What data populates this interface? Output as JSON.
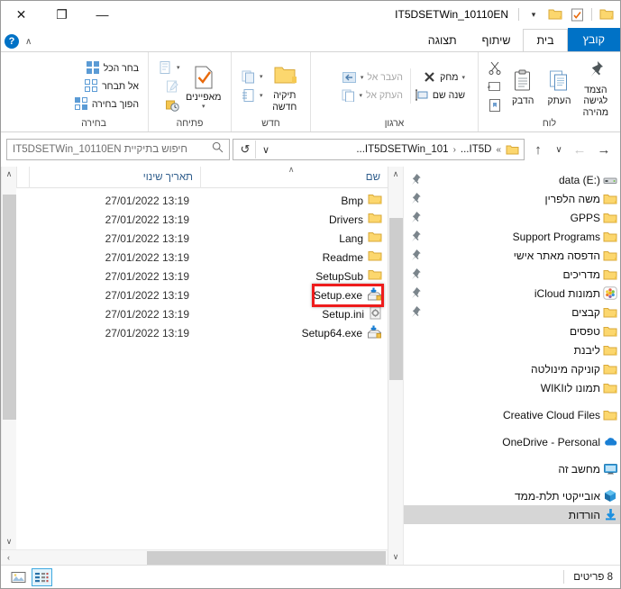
{
  "window": {
    "title": "IT5DSETWin_10110EN",
    "close_label": "✕",
    "maximize_label": "❐",
    "minimize_label": "—"
  },
  "quick_access_toolbar": {
    "items": [
      {
        "name": "customize-qat",
        "glyph": "▾"
      },
      {
        "name": "new-folder-qat",
        "glyph": "folder"
      },
      {
        "name": "properties-qat",
        "glyph": "properties"
      },
      {
        "name": "qat-folder-right",
        "glyph": "folder"
      }
    ]
  },
  "tabs": {
    "file": "קובץ",
    "items": [
      {
        "label": "בית",
        "active": true
      },
      {
        "label": "שיתוף",
        "active": false
      },
      {
        "label": "תצוגה",
        "active": false
      }
    ],
    "help_label": "?",
    "collapse_ribbon_glyph": "∧"
  },
  "ribbon": {
    "groups": [
      {
        "title": "לוח",
        "buttons": [
          {
            "label": "הצמד לגישה מהירה",
            "icon": "pin-icon"
          },
          {
            "label": "העתק",
            "icon": "copy-icon"
          },
          {
            "label": "הדבק",
            "icon": "paste-icon"
          }
        ],
        "small_buttons": [
          {
            "label": "",
            "icon": "cut-icon"
          },
          {
            "label": "",
            "icon": "copy-path-icon"
          },
          {
            "label": "",
            "icon": "paste-shortcut-icon"
          }
        ]
      },
      {
        "title": "ארגון",
        "small_buttons": [
          {
            "label": "העבר אל",
            "icon": "move-to-icon",
            "dropdown": true,
            "dimmed": true
          },
          {
            "label": "העתק אל",
            "icon": "copy-to-icon",
            "dropdown": true,
            "dimmed": true
          },
          {
            "label": "מחק",
            "icon": "delete-icon",
            "dropdown": true,
            "dimmed": false
          },
          {
            "label": "שנה שם",
            "icon": "rename-icon",
            "dropdown": false,
            "dimmed": false
          }
        ]
      },
      {
        "title": "חדש",
        "buttons": [
          {
            "label": "תיקיה חדשה",
            "icon": "new-folder-icon"
          }
        ],
        "small_buttons": [
          {
            "label": "",
            "icon": "new-item-icon",
            "dropdown": true
          },
          {
            "label": "",
            "icon": "easy-access-icon",
            "dropdown": true
          }
        ]
      },
      {
        "title": "פתיחה",
        "buttons": [
          {
            "label": "מאפיינים",
            "icon": "properties-icon",
            "dropdown": true
          }
        ],
        "small_buttons": [
          {
            "label": "",
            "icon": "open-icon",
            "dropdown": true,
            "dimmed": true
          },
          {
            "label": "",
            "icon": "edit-icon",
            "dimmed": true
          },
          {
            "label": "",
            "icon": "history-icon",
            "dimmed": false
          }
        ]
      },
      {
        "title": "בחירה",
        "small_buttons": [
          {
            "label": "בחר הכל",
            "icon": "select-all-icon"
          },
          {
            "label": "אל תבחר",
            "icon": "select-none-icon"
          },
          {
            "label": "הפוך בחירה",
            "icon": "invert-selection-icon"
          }
        ]
      }
    ]
  },
  "navigation": {
    "forward_glyph": "→",
    "back_glyph": "←",
    "recent_glyph": "∨",
    "up_glyph": "↑",
    "refresh_glyph": "↺",
    "breadcrumb_dropdown_glyph": "∨",
    "breadcrumb": [
      {
        "label": "»",
        "type": "overflow"
      },
      {
        "label": "...IT5D",
        "type": "crumb"
      },
      {
        "label": "‹",
        "type": "separator"
      },
      {
        "label": "...IT5DSETWin_101",
        "type": "crumb"
      }
    ],
    "search_placeholder": "חיפוש בתיקיית IT5DSETWin_10110EN",
    "search_icon": "search-icon"
  },
  "nav_pane": {
    "items": [
      {
        "label": "data (E:)",
        "icon": "drive",
        "pinned": true,
        "highlighted": false,
        "gap": false
      },
      {
        "label": "משה הלפרין",
        "icon": "folder",
        "pinned": true,
        "highlighted": false,
        "gap": false
      },
      {
        "label": "GPPS",
        "icon": "folder",
        "pinned": true,
        "highlighted": false,
        "gap": false
      },
      {
        "label": "Support Programs",
        "icon": "folder",
        "pinned": true,
        "highlighted": false,
        "gap": false
      },
      {
        "label": "הדפסה מאתר אישי",
        "icon": "folder",
        "pinned": true,
        "highlighted": false,
        "gap": false
      },
      {
        "label": "מדריכים",
        "icon": "folder",
        "pinned": true,
        "highlighted": false,
        "gap": false
      },
      {
        "label": "תמונות iCloud",
        "icon": "icloud",
        "pinned": true,
        "highlighted": false,
        "gap": false
      },
      {
        "label": "קבצים",
        "icon": "folder",
        "pinned": true,
        "highlighted": false,
        "gap": false
      },
      {
        "label": "טפסים",
        "icon": "folder",
        "pinned": false,
        "highlighted": false,
        "gap": false
      },
      {
        "label": "ליבנת",
        "icon": "folder",
        "pinned": false,
        "highlighted": false,
        "gap": false
      },
      {
        "label": "קוניקה מינולטה",
        "icon": "folder",
        "pinned": false,
        "highlighted": false,
        "gap": false
      },
      {
        "label": "תמונו לוWIKI",
        "icon": "folder",
        "pinned": false,
        "highlighted": false,
        "gap": false
      },
      {
        "label": "Creative Cloud Files",
        "icon": "folder",
        "pinned": false,
        "highlighted": false,
        "gap": true
      },
      {
        "label": "OneDrive - Personal",
        "icon": "onedrive",
        "pinned": false,
        "highlighted": false,
        "gap": true
      },
      {
        "label": "מחשב זה",
        "icon": "thispc",
        "pinned": false,
        "highlighted": false,
        "gap": true
      },
      {
        "label": "אובייקטי תלת-ממד",
        "icon": "3dobjects",
        "pinned": false,
        "highlighted": false,
        "gap": true
      },
      {
        "label": "הורדות",
        "icon": "downloads",
        "pinned": false,
        "highlighted": true,
        "gap": false
      }
    ]
  },
  "file_list": {
    "columns": [
      {
        "label": "שם",
        "key": "name",
        "sorted": true
      },
      {
        "label": "תאריך שינוי",
        "key": "date",
        "sorted": false
      }
    ],
    "sort_caret": "∧",
    "rows": [
      {
        "name": "Bmp",
        "date": "27/01/2022 13:19",
        "icon": "folder",
        "highlighted": false
      },
      {
        "name": "Drivers",
        "date": "27/01/2022 13:19",
        "icon": "folder",
        "highlighted": false
      },
      {
        "name": "Lang",
        "date": "27/01/2022 13:19",
        "icon": "folder",
        "highlighted": false
      },
      {
        "name": "Readme",
        "date": "27/01/2022 13:19",
        "icon": "folder",
        "highlighted": false
      },
      {
        "name": "SetupSub",
        "date": "27/01/2022 13:19",
        "icon": "folder",
        "highlighted": false
      },
      {
        "name": "Setup.exe",
        "date": "27/01/2022 13:19",
        "icon": "installer",
        "highlighted": true
      },
      {
        "name": "Setup.ini",
        "date": "27/01/2022 13:19",
        "icon": "ini",
        "highlighted": false
      },
      {
        "name": "Setup64.exe",
        "date": "27/01/2022 13:19",
        "icon": "installer",
        "highlighted": false
      }
    ]
  },
  "status_bar": {
    "item_count": "8 פריטים",
    "view_buttons": [
      {
        "name": "large-icons-view",
        "selected": false
      },
      {
        "name": "details-view",
        "selected": true
      }
    ]
  },
  "annotation": {
    "target": "Setup.exe",
    "color": "#ee1c1c"
  },
  "scroll": {
    "up_glyph": "∧",
    "down_glyph": "∨",
    "left_glyph": "‹",
    "right_glyph": "›"
  }
}
